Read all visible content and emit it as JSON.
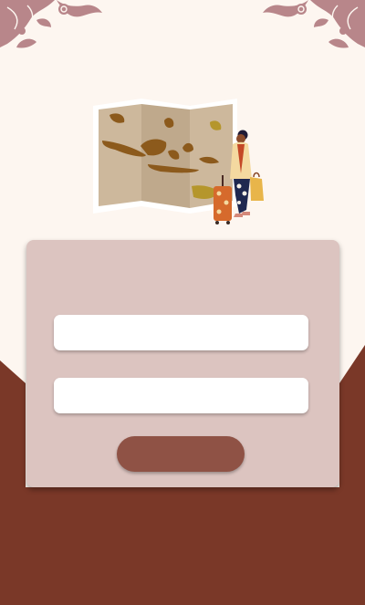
{
  "colors": {
    "page_background": "#fdf6f0",
    "bottom_background": "#7a3828",
    "card_background": "#dcc4c0",
    "input_background": "#ffffff",
    "button_background": "#8f5245",
    "ornament": "#b8868a"
  },
  "form": {
    "field_one": {
      "value": "",
      "placeholder": ""
    },
    "field_two": {
      "value": "",
      "placeholder": ""
    },
    "submit_label": ""
  },
  "icons": {
    "top_left": "floral-ornament-icon",
    "top_right": "floral-ornament-icon"
  }
}
